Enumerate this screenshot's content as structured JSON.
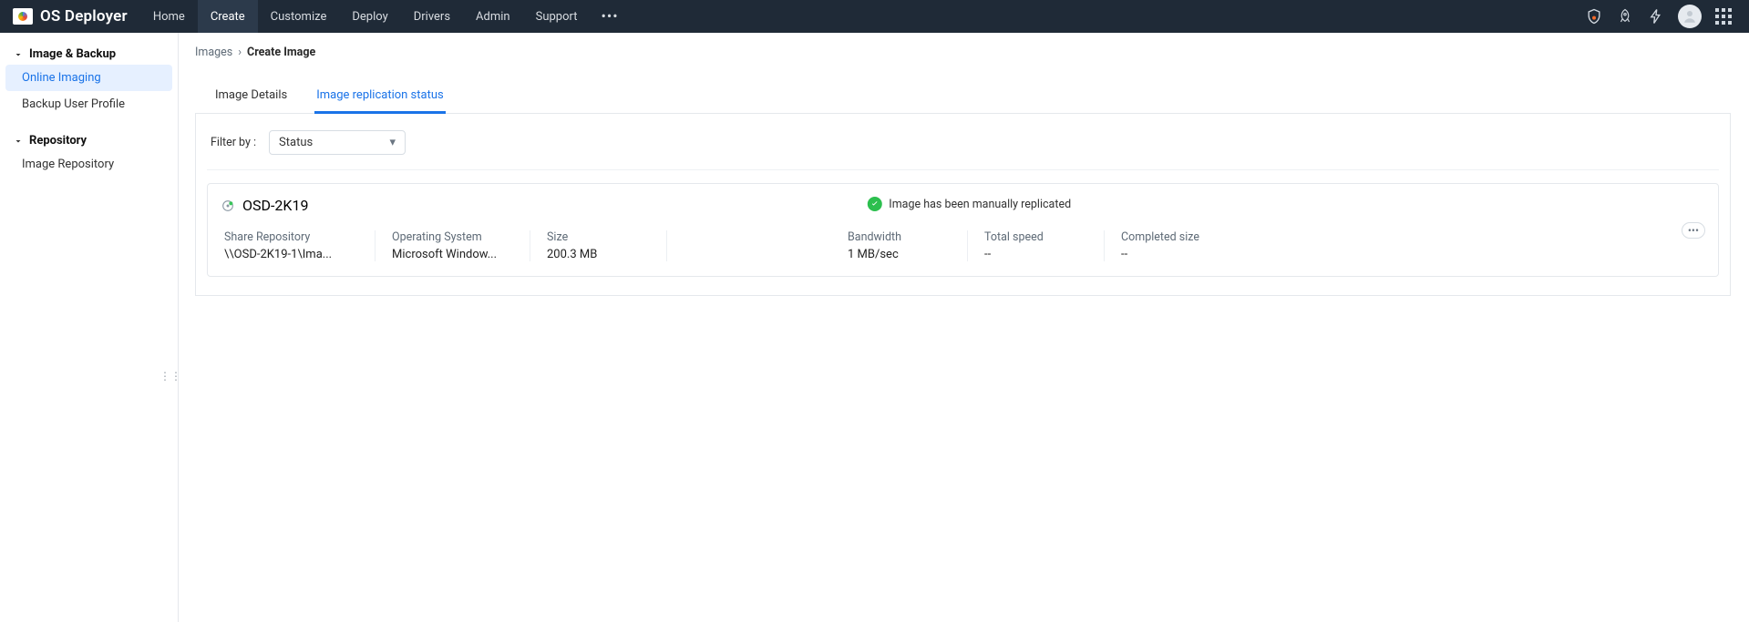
{
  "brand": "OS Deployer",
  "topnav": {
    "items": [
      "Home",
      "Create",
      "Customize",
      "Deploy",
      "Drivers",
      "Admin",
      "Support"
    ],
    "active_index": 1
  },
  "sidebar": {
    "groups": [
      {
        "title": "Image & Backup",
        "items": [
          "Online Imaging",
          "Backup User Profile"
        ],
        "active_index": 0
      },
      {
        "title": "Repository",
        "items": [
          "Image Repository"
        ],
        "active_index": -1
      }
    ]
  },
  "breadcrumb": {
    "root": "Images",
    "current": "Create Image"
  },
  "tabs": {
    "items": [
      "Image Details",
      "Image replication status"
    ],
    "active_index": 1
  },
  "filter": {
    "label": "Filter by :",
    "selected": "Status"
  },
  "replication": {
    "name": "OSD-2K19",
    "status_text": "Image has been manually replicated",
    "fields": {
      "share_repo": {
        "label": "Share Repository",
        "value": "\\\\OSD-2K19-1\\Ima..."
      },
      "os": {
        "label": "Operating System",
        "value": "Microsoft Window..."
      },
      "size": {
        "label": "Size",
        "value": "200.3 MB"
      },
      "bandwidth": {
        "label": "Bandwidth",
        "value": "1 MB/sec"
      },
      "total_speed": {
        "label": "Total speed",
        "value": "--"
      },
      "completed": {
        "label": "Completed size",
        "value": "--"
      }
    }
  }
}
